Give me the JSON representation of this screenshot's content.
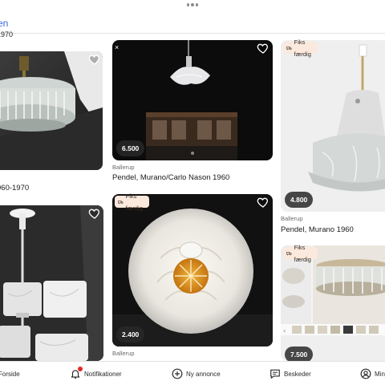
{
  "header": {
    "back_label": "en"
  },
  "listings": [
    {
      "partial_title_top": "1970",
      "title": "960-1970"
    },
    {
      "price": "6.500 kr.",
      "location": "Ballerup",
      "title": "Pendel, Murano/Carlo Nason 1960",
      "close_glyph": "×"
    },
    {
      "badge": "Fiks færdig",
      "price": "4.800 kr.",
      "location": "Ballerup",
      "title": "Pendel, Murano 1960"
    },
    {},
    {
      "badge": "Fiks færdig",
      "price": "2.400 kr.",
      "location": "Ballerup"
    },
    {
      "badge": "Fiks færdig",
      "price": "7.500 kr."
    }
  ],
  "bottom_nav": {
    "home": "Forside",
    "notifications": "Notifikationer",
    "new_ad": "Ny annonce",
    "messages": "Beskeder",
    "profile": "Min"
  },
  "colors": {
    "accent": "#3b63d9",
    "badge_bg": "#fbe9dd",
    "notification_dot": "#e02828"
  }
}
